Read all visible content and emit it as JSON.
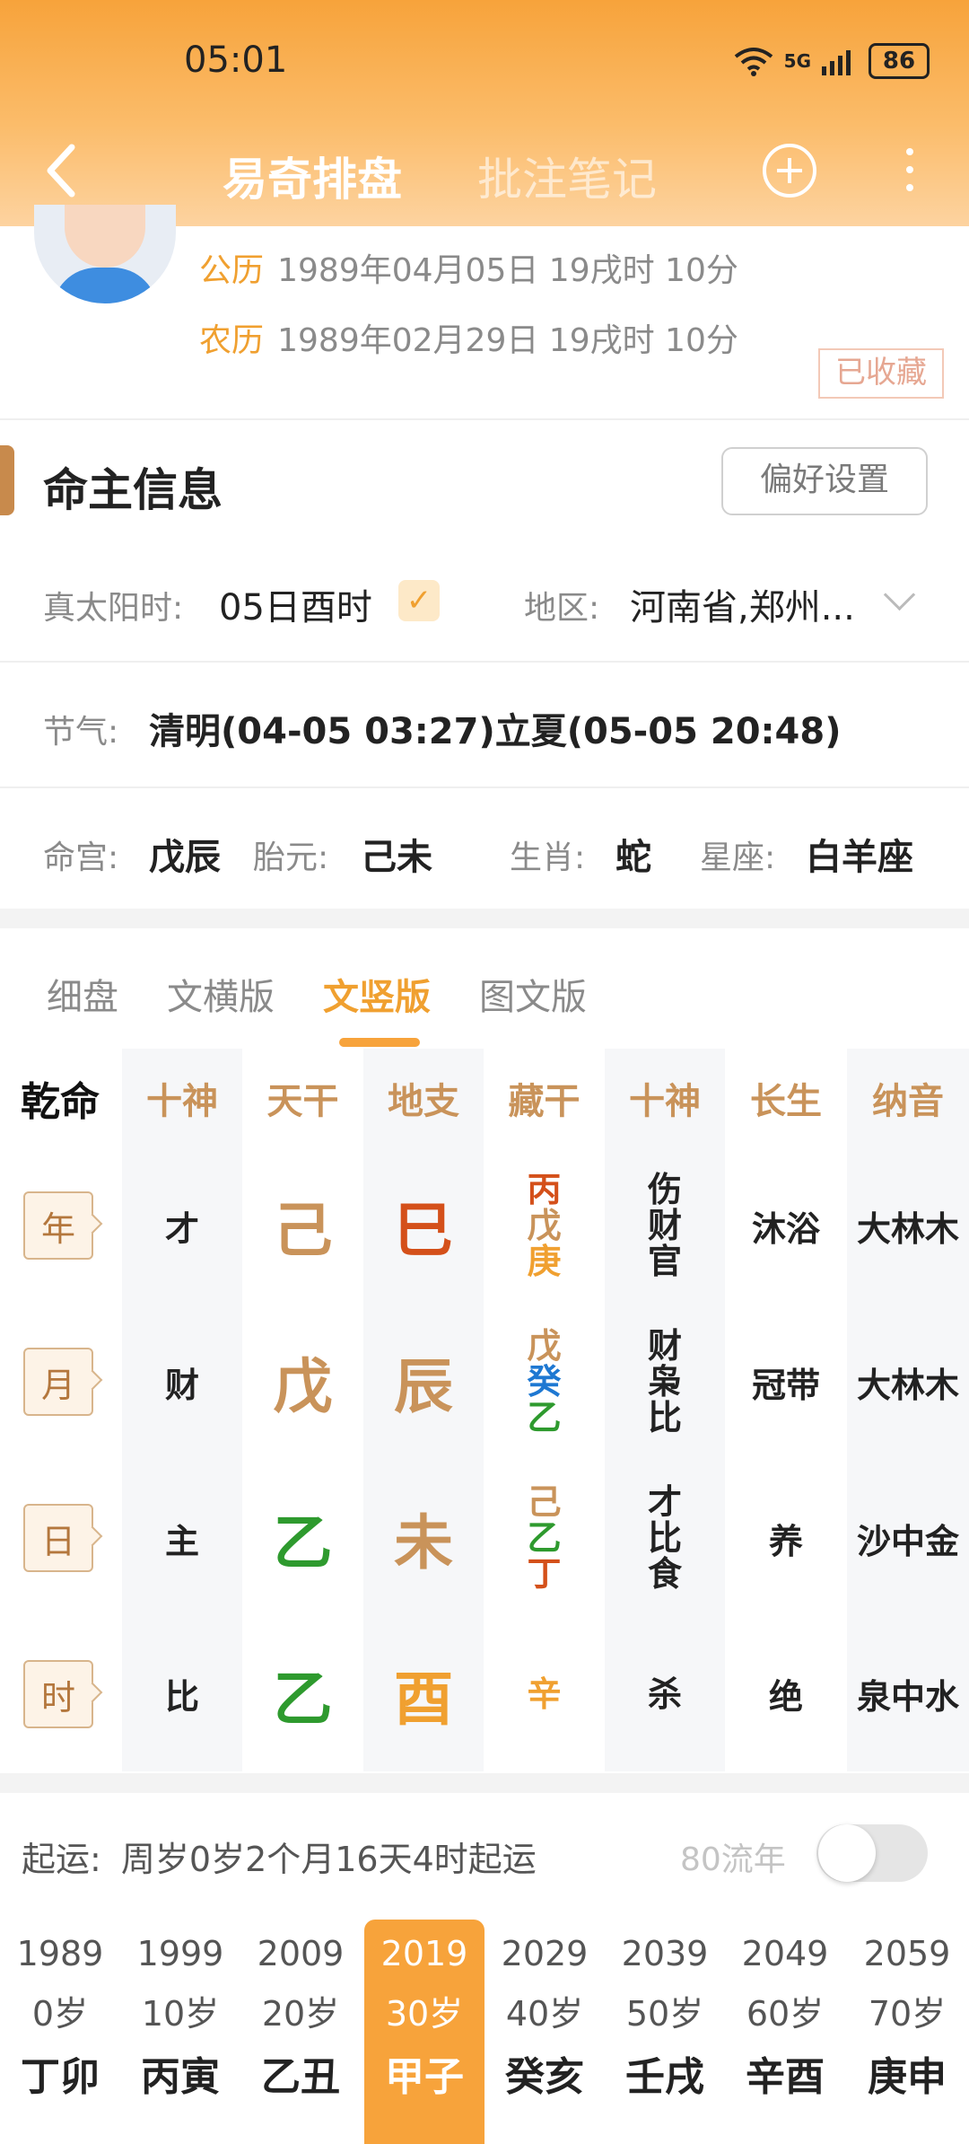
{
  "status": {
    "time": "05:01",
    "network": "5G",
    "battery": "86"
  },
  "nav": {
    "tab_active": "易奇排盘",
    "tab_inactive": "批注笔记"
  },
  "profile": {
    "solar_label": "公历",
    "solar_value": "1989年04月05日 19戌时 10分",
    "lunar_label": "农历",
    "lunar_value": "1989年02月29日 19戌时 10分",
    "collected": "已收藏"
  },
  "section": {
    "title": "命主信息",
    "pref_button": "偏好设置"
  },
  "info": {
    "true_solar_label": "真太阳时:",
    "true_solar_value": "05日酉时",
    "region_label": "地区:",
    "region_value": "河南省,郑州...",
    "jieqi_label": "节气:",
    "jieqi_value": "清明(04-05 03:27)立夏(05-05 20:48)",
    "minggong_label": "命宫:",
    "minggong_value": "戊辰",
    "taiyuan_label": "胎元:",
    "taiyuan_value": "己未",
    "shengxiao_label": "生肖:",
    "shengxiao_value": "蛇",
    "xingzuo_label": "星座:",
    "xingzuo_value": "白羊座"
  },
  "view_tabs": [
    "细盘",
    "文横版",
    "文竖版",
    "图文版"
  ],
  "active_view_tab": "文竖版",
  "table": {
    "corner": "乾命",
    "headers": [
      "十神",
      "天干",
      "地支",
      "藏干",
      "十神",
      "长生",
      "纳音"
    ],
    "rows": [
      {
        "pillar": "年",
        "shishen": "才",
        "gan": "己",
        "zhi": "巳",
        "canggan": [
          "丙",
          "戊",
          "庚"
        ],
        "canggan_shishen": [
          "伤",
          "财",
          "官"
        ],
        "changsheng": "沐浴",
        "nayin": "大林木"
      },
      {
        "pillar": "月",
        "shishen": "财",
        "gan": "戊",
        "zhi": "辰",
        "canggan": [
          "戊",
          "癸",
          "乙"
        ],
        "canggan_shishen": [
          "财",
          "枭",
          "比"
        ],
        "changsheng": "冠带",
        "nayin": "大林木"
      },
      {
        "pillar": "日",
        "shishen": "主",
        "gan": "乙",
        "zhi": "未",
        "canggan": [
          "己",
          "乙",
          "丁"
        ],
        "canggan_shishen": [
          "才",
          "比",
          "食"
        ],
        "changsheng": "养",
        "nayin": "沙中金"
      },
      {
        "pillar": "时",
        "shishen": "比",
        "gan": "乙",
        "zhi": "酉",
        "canggan": [
          "辛"
        ],
        "canggan_shishen": [
          "杀"
        ],
        "changsheng": "绝",
        "nayin": "泉中水"
      }
    ],
    "colors": {
      "earth": "#c9935a",
      "fire": "#d4501a",
      "wood": "#2e9a2e",
      "water": "#1e78d2",
      "metal": "#f0a030"
    }
  },
  "qiyun": {
    "label": "起运:",
    "value": "周岁0岁2个月16天4时起运",
    "liunian_label": "80流年",
    "liunian_on": false
  },
  "dayun": [
    {
      "year": "1989",
      "age": "0岁",
      "ganzhi": "丁卯"
    },
    {
      "year": "1999",
      "age": "10岁",
      "ganzhi": "丙寅"
    },
    {
      "year": "2009",
      "age": "20岁",
      "ganzhi": "乙丑"
    },
    {
      "year": "2019",
      "age": "30岁",
      "ganzhi": "甲子"
    },
    {
      "year": "2029",
      "age": "40岁",
      "ganzhi": "癸亥"
    },
    {
      "year": "2039",
      "age": "50岁",
      "ganzhi": "壬戌"
    },
    {
      "year": "2049",
      "age": "60岁",
      "ganzhi": "辛酉"
    },
    {
      "year": "2059",
      "age": "70岁",
      "ganzhi": "庚申"
    }
  ],
  "active_dayun_index": 3
}
